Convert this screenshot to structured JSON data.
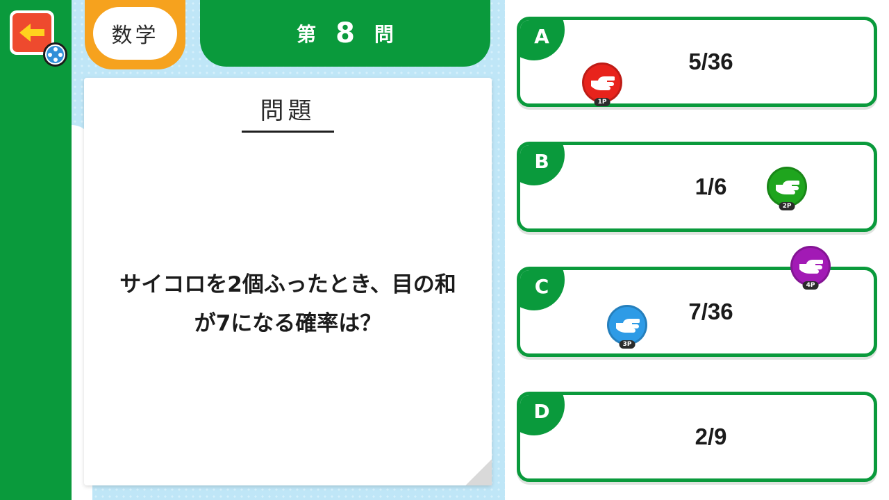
{
  "header": {
    "subject": "数学",
    "question_prefix": "第",
    "question_number": "8",
    "question_suffix": "問"
  },
  "question": {
    "title": "問題",
    "line1": "サイコロを2個ふったとき、目の和",
    "line2": "が7になる確率は？"
  },
  "answers": [
    {
      "letter": "A",
      "value": "5/36"
    },
    {
      "letter": "B",
      "value": "1/6"
    },
    {
      "letter": "C",
      "value": "7/36"
    },
    {
      "letter": "D",
      "value": "2/9"
    }
  ],
  "players": [
    {
      "label": "1P",
      "color": "#e8231c",
      "icon": "pointing-hand-icon"
    },
    {
      "label": "2P",
      "color": "#1fa51e",
      "icon": "pointing-hand-icon"
    },
    {
      "label": "3P",
      "color": "#2e9be6",
      "icon": "pointing-hand-icon"
    },
    {
      "label": "4P",
      "color": "#a21ab5",
      "icon": "pointing-hand-icon"
    }
  ],
  "colors": {
    "green": "#0a9a3c",
    "orange": "#f6a21e",
    "back_button": "#ee4a2e"
  },
  "icons": {
    "back": "back-arrow-icon",
    "controller": "controller-icon"
  }
}
